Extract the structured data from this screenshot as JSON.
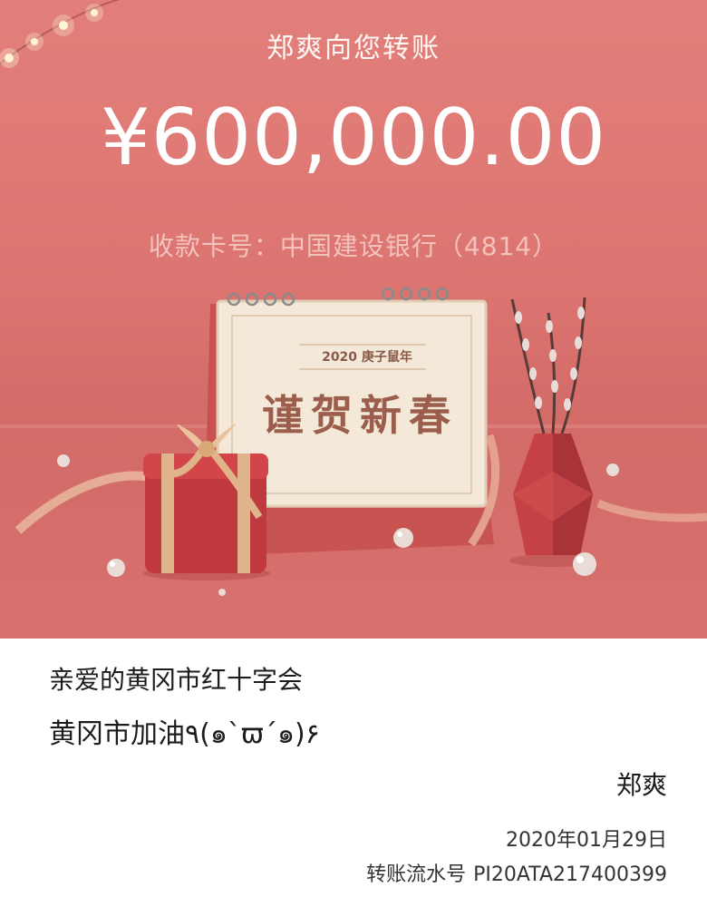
{
  "header": {
    "title": "郑爽向您转账",
    "amount": "¥600,000.00",
    "account_label": "收款卡号：中国建设银行（4814）"
  },
  "illustration": {
    "calendar_year_text": "2020 庚子鼠年",
    "calendar_greeting": "谨贺新春",
    "icons": [
      "string-lights-icon",
      "gift-box-icon",
      "calendar-icon",
      "vase-icon",
      "pearl-icon",
      "ribbon-icon"
    ]
  },
  "message": {
    "greeting": "亲爱的黄冈市红十字会",
    "cheer": "黄冈市加油٩(๑`ϖ´๑)۶",
    "signer": "郑爽",
    "date": "2020年01月29日",
    "serial_label": "转账流水号",
    "serial_number": "PI20ATA217400399"
  },
  "colors": {
    "banner": "#dc7571",
    "text_white": "#ffffff",
    "account_text": "#f4c2bd",
    "body_text": "#1c1c1c"
  }
}
